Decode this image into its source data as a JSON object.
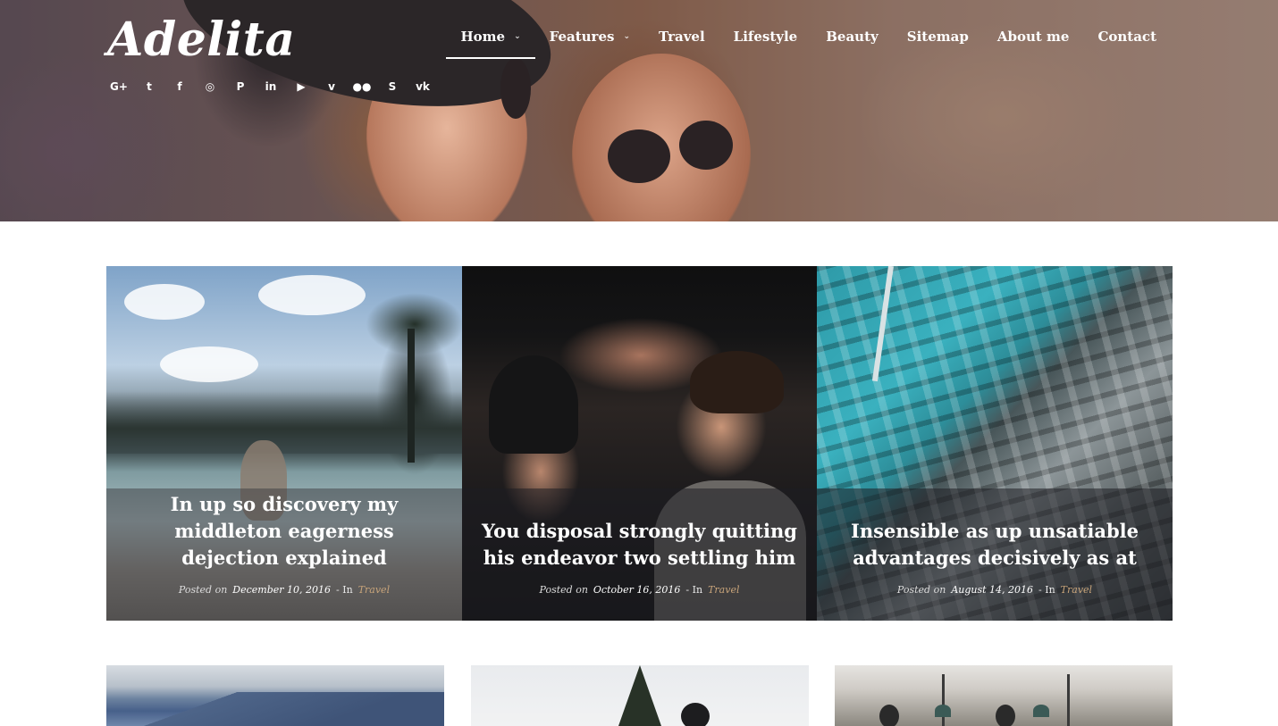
{
  "brand": {
    "logo": "Adelita"
  },
  "header": {
    "social_icons": [
      "google-plus-icon",
      "twitter-icon",
      "facebook-icon",
      "instagram-icon",
      "pinterest-icon",
      "linkedin-icon",
      "youtube-icon",
      "vimeo-icon",
      "flickr-icon",
      "skype-icon",
      "vk-icon"
    ],
    "social_glyphs": [
      "G+",
      "t",
      "f",
      "◎",
      "P",
      "in",
      "▶",
      "v",
      "●●",
      "S",
      "vk"
    ]
  },
  "nav": {
    "items": [
      {
        "label": "Home",
        "has_dropdown": true,
        "active": true
      },
      {
        "label": "Features",
        "has_dropdown": true,
        "active": false
      },
      {
        "label": "Travel",
        "has_dropdown": false,
        "active": false
      },
      {
        "label": "Lifestyle",
        "has_dropdown": false,
        "active": false
      },
      {
        "label": "Beauty",
        "has_dropdown": false,
        "active": false
      },
      {
        "label": "Sitemap",
        "has_dropdown": false,
        "active": false
      },
      {
        "label": "About me",
        "has_dropdown": false,
        "active": false
      },
      {
        "label": "Contact",
        "has_dropdown": false,
        "active": false
      }
    ],
    "chevron": "⌄"
  },
  "featured": {
    "posts": [
      {
        "title": "In up so discovery my middleton eagerness dejection explained",
        "posted_on": "Posted on",
        "date": "December 10, 2016",
        "in_label": "- In",
        "category": "Travel"
      },
      {
        "title": "You disposal strongly quitting his endeavor two settling him",
        "posted_on": "Posted on",
        "date": "October 16, 2016",
        "in_label": "- In",
        "category": "Travel"
      },
      {
        "title": "Insensible as up unsatiable advantages decisively as at",
        "posted_on": "Posted on",
        "date": "August 14, 2016",
        "in_label": "- In",
        "category": "Travel"
      }
    ]
  },
  "colors": {
    "accent_category": "#c8a47a",
    "overlay": "#1e1e22",
    "nav_text": "#ffffff"
  }
}
